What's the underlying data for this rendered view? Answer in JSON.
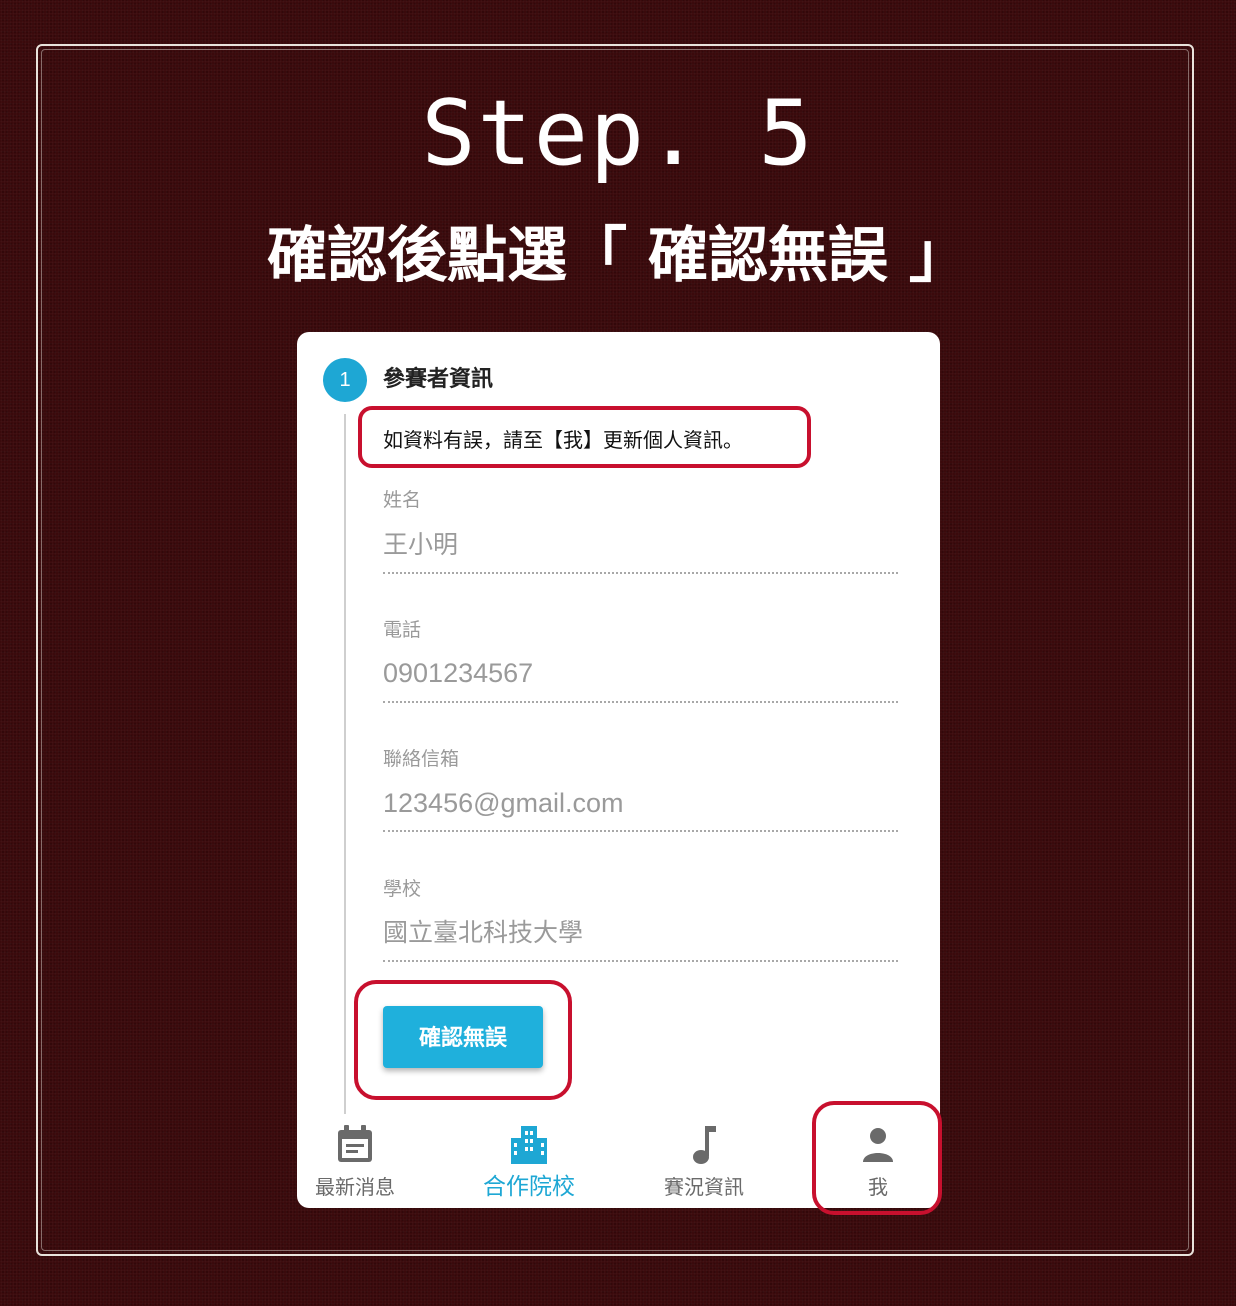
{
  "header": {
    "step_title": "Step. 5",
    "instruction": "確認後點選「 確認無誤 」"
  },
  "form": {
    "step_number": "1",
    "section_title": "參賽者資訊",
    "notice": "如資料有誤，請至【我】更新個人資訊。",
    "fields": [
      {
        "label": "姓名",
        "value": "王小明"
      },
      {
        "label": "電話",
        "value": "0901234567"
      },
      {
        "label": "聯絡信箱",
        "value": "123456@gmail.com"
      },
      {
        "label": "學校",
        "value": "國立臺北科技大學"
      }
    ],
    "confirm_button": "確認無誤"
  },
  "bottom_nav": {
    "items": [
      {
        "label": "最新消息",
        "icon": "calendar-icon"
      },
      {
        "label": "合作院校",
        "icon": "building-icon",
        "active": true
      },
      {
        "label": "賽況資訊",
        "icon": "music-note-icon"
      },
      {
        "label": "我",
        "icon": "person-icon"
      }
    ]
  },
  "colors": {
    "background": "#3a0a0c",
    "accent": "#1ea7d4",
    "highlight": "#c8102e"
  }
}
